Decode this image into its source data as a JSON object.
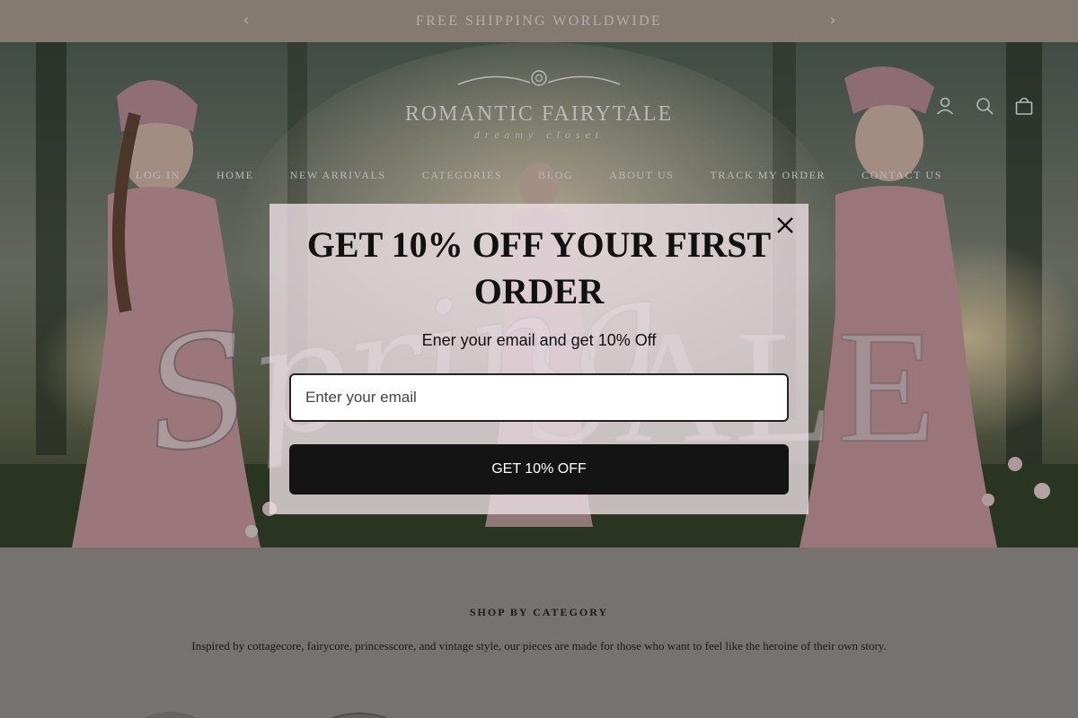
{
  "announcement": {
    "text": "FREE SHIPPING WORLDWIDE",
    "prev_icon": "chevron-left-icon",
    "next_icon": "chevron-right-icon"
  },
  "header": {
    "logo_main": "ROMANTIC FAIRYTALE",
    "logo_sub": "dreamy closet",
    "icons": [
      "user-icon",
      "search-icon",
      "bag-icon"
    ]
  },
  "nav": {
    "items": [
      "LOG IN",
      "HOME",
      "NEW ARRIVALS",
      "CATEGORIES",
      "BLOG",
      "ABOUT US",
      "TRACK MY ORDER",
      "CONTACT US"
    ]
  },
  "hero": {
    "script_word": "Spring",
    "sale_word": "SALE"
  },
  "popup": {
    "title": "GET 10% OFF YOUR FIRST ORDER",
    "text": "Ener your email and get 10% Off",
    "email_placeholder": "Enter your email",
    "email_value": "",
    "button_label": "GET 10% OFF",
    "close_icon": "close-icon"
  },
  "section": {
    "title": "SHOP BY CATEGORY",
    "description": "Inspired by cottagecore, fairycore, princesscore, and vintage style, our pieces are made for those who want to feel like the heroine of their own story."
  },
  "colors": {
    "announcement_bg": "#b9a99c",
    "button_bg": "#141414",
    "popup_bg": "#eee1e8"
  }
}
